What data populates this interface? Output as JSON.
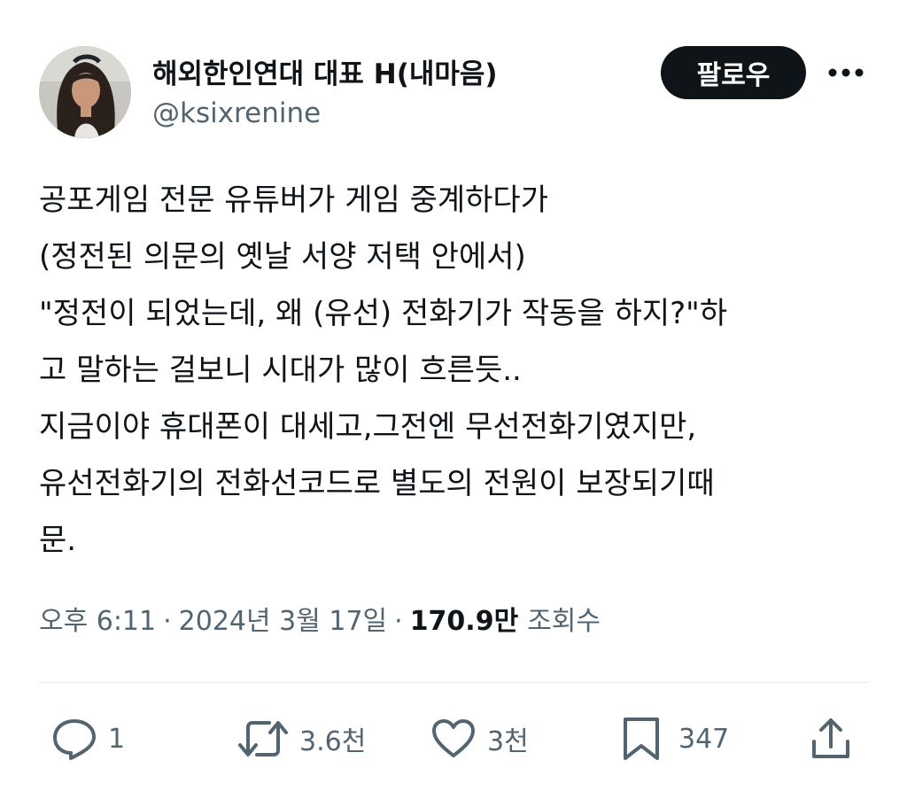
{
  "author": {
    "display_name": "해외한인연대 대표 H(내마음)",
    "handle": "@ksixrenine"
  },
  "buttons": {
    "follow_label": "팔로우"
  },
  "tweet": {
    "text": "공포게임 전문 유튜버가 게임 중계하다가\n(정전된 의문의 옛날 서양 저택 안에서)\n\"정전이 되었는데, 왜 (유선) 전화기가 작동을 하지?\"하\n고 말하는 걸보니 시대가 많이 흐른듯..\n지금이야 휴대폰이 대세고,그전엔 무선전화기였지만,\n유선전화기의 전화선코드로 별도의 전원이 보장되기때\n문."
  },
  "meta": {
    "time": "오후 6:11",
    "date": "2024년 3월 17일",
    "separator": "·",
    "views_count": "170.9만",
    "views_label": "조회수"
  },
  "actions": {
    "reply_count": "1",
    "retweet_count": "3.6천",
    "like_count": "3천",
    "bookmark_count": "347"
  },
  "icons": {
    "more": "more-horizontal-icon",
    "reply": "reply-icon",
    "retweet": "retweet-icon",
    "like": "heart-icon",
    "bookmark": "bookmark-icon",
    "share": "share-icon"
  },
  "colors": {
    "text_primary": "#0f1419",
    "text_secondary": "#536471",
    "follow_bg": "#0f1419",
    "divider": "#e6e9eb"
  }
}
